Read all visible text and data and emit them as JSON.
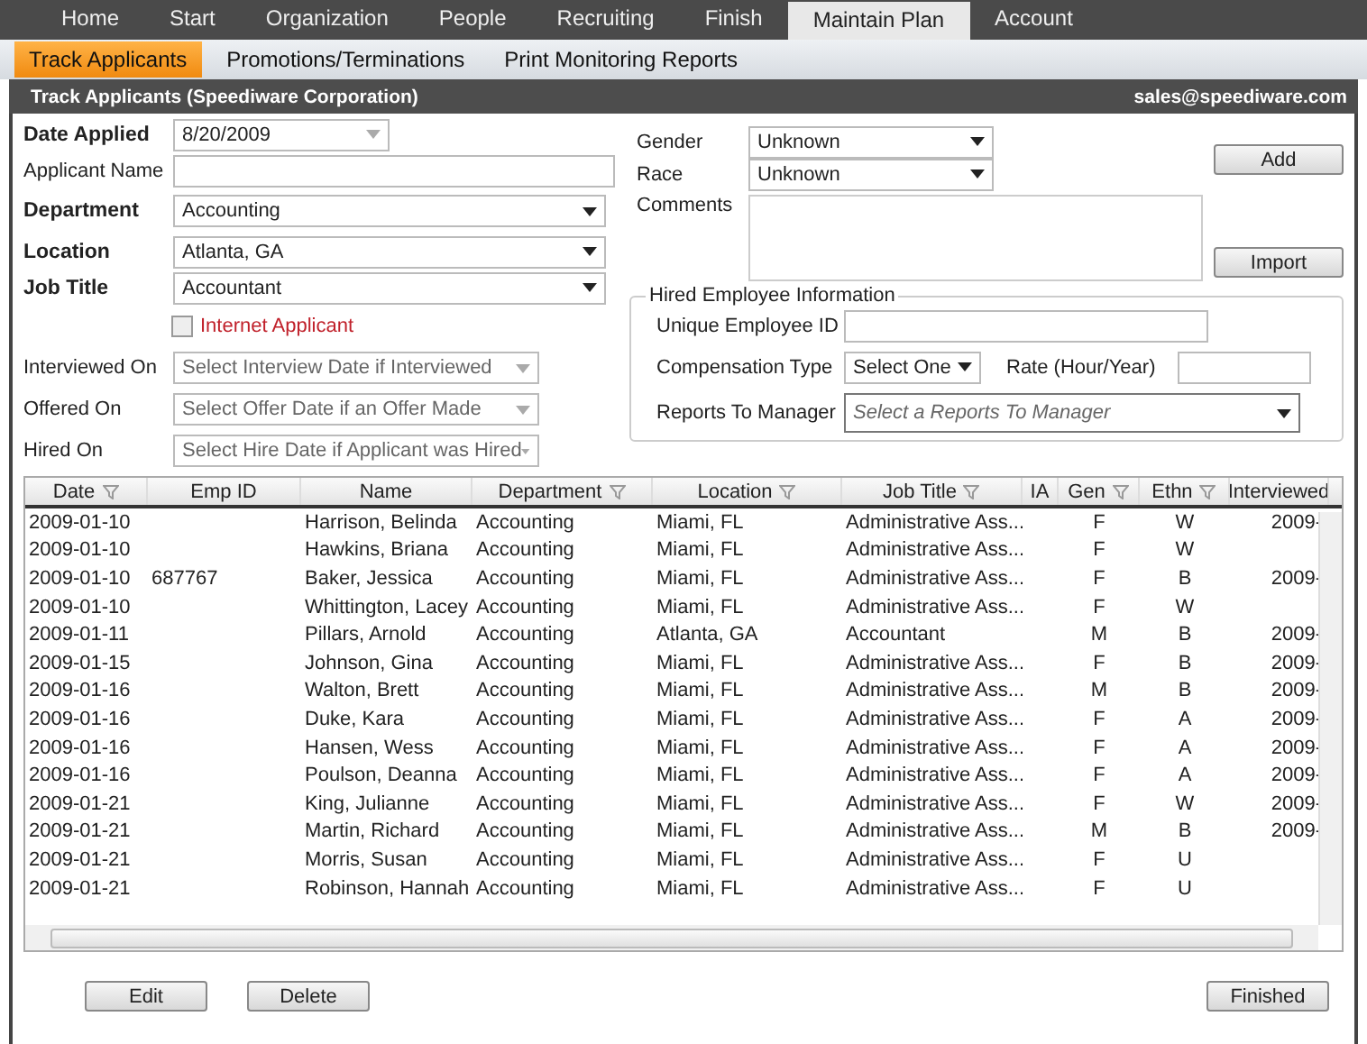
{
  "nav": {
    "tabs": [
      {
        "label": "Home",
        "selected": false
      },
      {
        "label": "Start",
        "selected": false
      },
      {
        "label": "Organization",
        "selected": false
      },
      {
        "label": "People",
        "selected": false
      },
      {
        "label": "Recruiting",
        "selected": false
      },
      {
        "label": "Finish",
        "selected": false
      },
      {
        "label": "Maintain Plan",
        "selected": true
      },
      {
        "label": "Account",
        "selected": false
      }
    ]
  },
  "subnav": {
    "tabs": [
      {
        "label": "Track Applicants",
        "selected": true
      },
      {
        "label": "Promotions/Terminations",
        "selected": false
      },
      {
        "label": "Print Monitoring Reports",
        "selected": false
      }
    ]
  },
  "title_bar": {
    "title": "Track Applicants (Speediware Corporation)",
    "email": "sales@speediware.com"
  },
  "form": {
    "fields": [
      {
        "label": "Date Applied",
        "required": true,
        "kind": "date",
        "value": "8/20/2009"
      },
      {
        "label": "Applicant Name",
        "required": false,
        "kind": "text"
      },
      {
        "label": "Department",
        "required": true,
        "kind": "select",
        "value": "Accounting"
      },
      {
        "label": "Location",
        "required": true,
        "kind": "select",
        "value": "Atlanta, GA"
      },
      {
        "label": "Job Title",
        "required": true,
        "kind": "select",
        "value": "Accountant"
      }
    ],
    "internet_applicant": {
      "label": "Internet Applicant",
      "checked": false
    },
    "date_fields": [
      {
        "label": "Interviewed On",
        "placeholder": "Select Interview Date if Interviewed"
      },
      {
        "label": "Offered On",
        "placeholder": "Select Offer Date if an Offer Made"
      },
      {
        "label": "Hired On",
        "placeholder": "Select Hire Date if Applicant was Hired"
      }
    ],
    "gender": {
      "label": "Gender",
      "value": "Unknown"
    },
    "race": {
      "label": "Race",
      "value": "Unknown"
    },
    "comments": {
      "label": "Comments"
    },
    "add_button": "Add",
    "import_button": "Import",
    "hired_info": {
      "legend": "Hired Employee Information",
      "employee_id_label": "Unique Employee ID",
      "compensation_label": "Compensation Type",
      "compensation_value": "Select One",
      "rate_label": "Rate (Hour/Year)",
      "manager_label": "Reports To Manager",
      "manager_placeholder": "Select a Reports To Manager"
    }
  },
  "table": {
    "columns": [
      {
        "label": "Date",
        "filter": true
      },
      {
        "label": "Emp ID",
        "filter": false
      },
      {
        "label": "Name",
        "filter": false
      },
      {
        "label": "Department",
        "filter": true
      },
      {
        "label": "Location",
        "filter": true
      },
      {
        "label": "Job Title",
        "filter": true
      },
      {
        "label": "IA",
        "filter": false
      },
      {
        "label": "Gen",
        "filter": true
      },
      {
        "label": "Ethn",
        "filter": true
      },
      {
        "label": "Interviewed",
        "filter": false
      }
    ],
    "rows": [
      [
        "2009-01-10",
        "",
        "Harrison, Belinda",
        "Accounting",
        "Miami, FL",
        "Administrative Ass...",
        "",
        "F",
        "W",
        "2009-"
      ],
      [
        "2009-01-10",
        "",
        "Hawkins, Briana",
        "Accounting",
        "Miami, FL",
        "Administrative Ass...",
        "",
        "F",
        "W",
        ""
      ],
      [
        "2009-01-10",
        "687767",
        "Baker, Jessica",
        "Accounting",
        "Miami, FL",
        "Administrative Ass...",
        "",
        "F",
        "B",
        "2009-"
      ],
      [
        "2009-01-10",
        "",
        "Whittington, Lacey",
        "Accounting",
        "Miami, FL",
        "Administrative Ass...",
        "",
        "F",
        "W",
        ""
      ],
      [
        "2009-01-11",
        "",
        "Pillars, Arnold",
        "Accounting",
        "Atlanta, GA",
        "Accountant",
        "",
        "M",
        "B",
        "2009-"
      ],
      [
        "2009-01-15",
        "",
        "Johnson, Gina",
        "Accounting",
        "Miami, FL",
        "Administrative Ass...",
        "",
        "F",
        "B",
        "2009-"
      ],
      [
        "2009-01-16",
        "",
        "Walton, Brett",
        "Accounting",
        "Miami, FL",
        "Administrative Ass...",
        "",
        "M",
        "B",
        "2009-"
      ],
      [
        "2009-01-16",
        "",
        "Duke, Kara",
        "Accounting",
        "Miami, FL",
        "Administrative Ass...",
        "",
        "F",
        "A",
        "2009-"
      ],
      [
        "2009-01-16",
        "",
        "Hansen, Wess",
        "Accounting",
        "Miami, FL",
        "Administrative Ass...",
        "",
        "F",
        "A",
        "2009-"
      ],
      [
        "2009-01-16",
        "",
        "Poulson, Deanna",
        "Accounting",
        "Miami, FL",
        "Administrative Ass...",
        "",
        "F",
        "A",
        "2009-"
      ],
      [
        "2009-01-21",
        "",
        "King, Julianne",
        "Accounting",
        "Miami, FL",
        "Administrative Ass...",
        "",
        "F",
        "W",
        "2009-"
      ],
      [
        "2009-01-21",
        "",
        "Martin, Richard",
        "Accounting",
        "Miami, FL",
        "Administrative Ass...",
        "",
        "M",
        "B",
        "2009-"
      ],
      [
        "2009-01-21",
        "",
        "Morris, Susan",
        "Accounting",
        "Miami, FL",
        "Administrative Ass...",
        "",
        "F",
        "U",
        ""
      ],
      [
        "2009-01-21",
        "",
        "Robinson, Hannah",
        "Accounting",
        "Miami, FL",
        "Administrative Ass...",
        "",
        "F",
        "U",
        ""
      ]
    ]
  },
  "footer": {
    "edit": "Edit",
    "delete": "Delete",
    "finished": "Finished"
  }
}
